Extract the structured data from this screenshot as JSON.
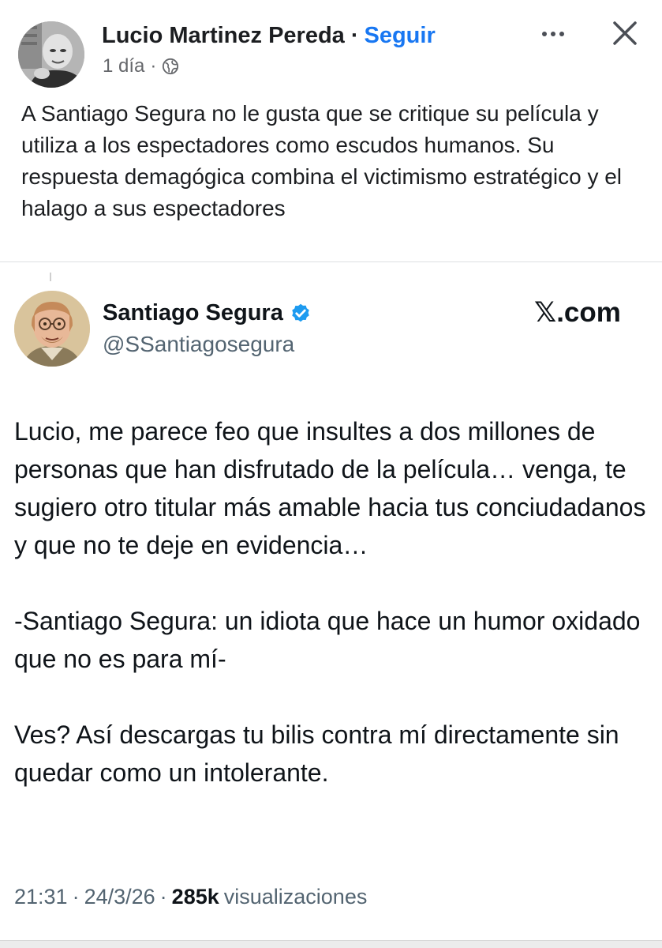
{
  "post": {
    "author_name": "Lucio Martinez Pereda",
    "follow_label": "Seguir",
    "separator": "·",
    "time_ago": "1 día",
    "audience_icon": "globe-icon",
    "more_icon": "more-dots-icon",
    "close_icon": "close-icon",
    "text": "A Santiago Segura no le gusta que se critique su película y utiliza a los espectadores como escudos humanos. Su respuesta demagógica combina el victimismo estratégico y el halago a sus espectadores"
  },
  "tweet": {
    "author_name": "Santiago Segura",
    "handle": "@SSantiagosegura",
    "verified_icon": "verified-badge-icon",
    "brand": "𝕏.com",
    "paragraphs": [
      "Lucio, me parece feo que insultes a dos millones de personas que han disfrutado de la película… venga, te sugiero otro titular más amable hacia tus conciudadanos y que no te deje en evidencia…",
      "-Santiago Segura: un idiota que hace un humor oxidado que no es para mí-",
      "Ves? Así descargas tu bilis contra mí directamente sin quedar como un intolerante."
    ],
    "time": "21:31",
    "date": "24/3/26",
    "separator": "·",
    "views_count": "285k",
    "views_label": "visualizaciones"
  },
  "colors": {
    "link_blue": "#1877f2",
    "verified_blue": "#1d9bf0",
    "secondary_text": "#65676b",
    "tweet_secondary_text": "#536471"
  }
}
